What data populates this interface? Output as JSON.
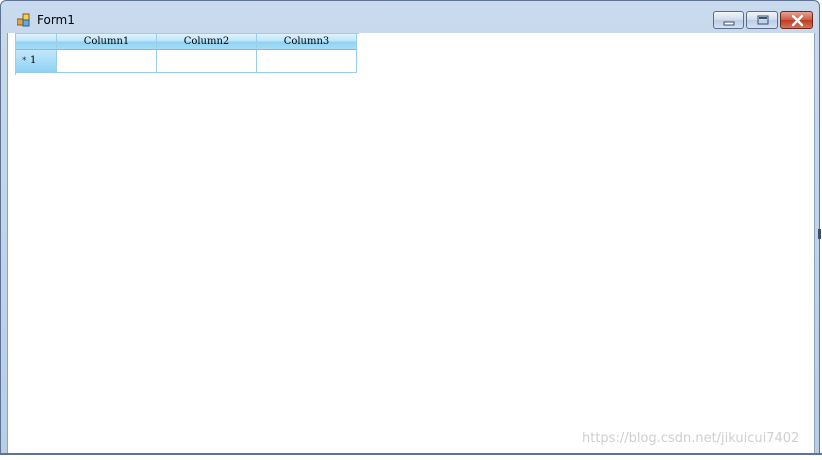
{
  "window": {
    "title": "Form1",
    "icon": "form-icon",
    "controls": {
      "minimize": "minimize-icon",
      "maximize": "maximize-icon",
      "close": "close-icon"
    }
  },
  "grid": {
    "columns": [
      "Column1",
      "Column2",
      "Column3"
    ],
    "rows": [
      {
        "header": "1",
        "indicator": "*",
        "cells": [
          "",
          "",
          ""
        ]
      }
    ]
  },
  "watermark": "https://blog.csdn.net/jikuicui7402",
  "colors": {
    "header_gradient_top": "#dff3fd",
    "header_gradient_bottom": "#8fd2f3",
    "grid_line": "#9ccde8",
    "close_button": "#c03a22"
  }
}
